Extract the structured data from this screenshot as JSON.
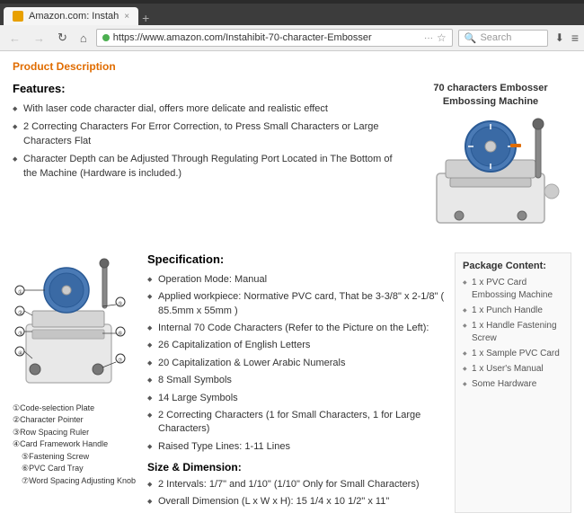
{
  "browser": {
    "tab_label": "Amazon.com: Instah",
    "tab_close": "×",
    "tab_new": "+",
    "url": "https://www.amazon.com/Instahibit-70-character-Embosser",
    "url_dots": "···",
    "url_star": "☆",
    "search_placeholder": "Search",
    "nav_back": "←",
    "nav_forward": "→",
    "nav_reload": "↻",
    "nav_home": "⌂",
    "nav_download": "⬇",
    "nav_menu": "≡"
  },
  "page": {
    "product_description_label": "Product Description",
    "image_caption_line1": "70 characters Embosser",
    "image_caption_line2": "Embossing Machine",
    "features_title": "Features:",
    "features": [
      "With laser code character dial, offers more delicate and realistic effect",
      "2 Correcting Characters For Error Correction, to Press Small Characters or Large Characters Flat",
      "Character Depth can be Adjusted Through Regulating Port Located in The Bottom of the Machine (Hardware is included.)"
    ],
    "specs_title": "Specification:",
    "specs": [
      "Operation Mode: Manual",
      "Applied workpiece: Normative PVC card, That be 3-3/8\" x 2-1/8\" ( 85.5mm x 55mm )",
      "Internal 70 Code Characters (Refer to the Picture on the Left):",
      "26 Capitalization of English Letters",
      "20 Capitalization & Lower Arabic Numerals",
      "8 Small Symbols",
      "14 Large Symbols",
      "2 Correcting Characters (1 for Small Characters, 1 for Large Characters)",
      "Raised Type Lines: 1-11 Lines"
    ],
    "size_dimension_title": "Size & Dimension:",
    "size_specs": [
      "2 Intervals: 1/7\" and 1/10\" (1/10\" Only for Small Characters)",
      "Overall Dimension (L x W x H): 15 1/4 x 10 1/2\" x 11\""
    ],
    "package_title": "Package Content:",
    "package_items": [
      "1 x PVC Card Embossing Machine",
      "1 x Punch Handle",
      "1 x Handle Fastening Screw",
      "1 x Sample PVC Card",
      "1 x User's Manual",
      "Some Hardware"
    ],
    "diagram_labels": [
      "①Code-selection Plate",
      "②Character Pointer",
      "③Row Spacing Ruler",
      "④Card Framework Handle",
      "⑤Fastening Screw",
      "⑥PVC Card Tray",
      "⑦Word Spacing Adjusting Knob"
    ]
  }
}
